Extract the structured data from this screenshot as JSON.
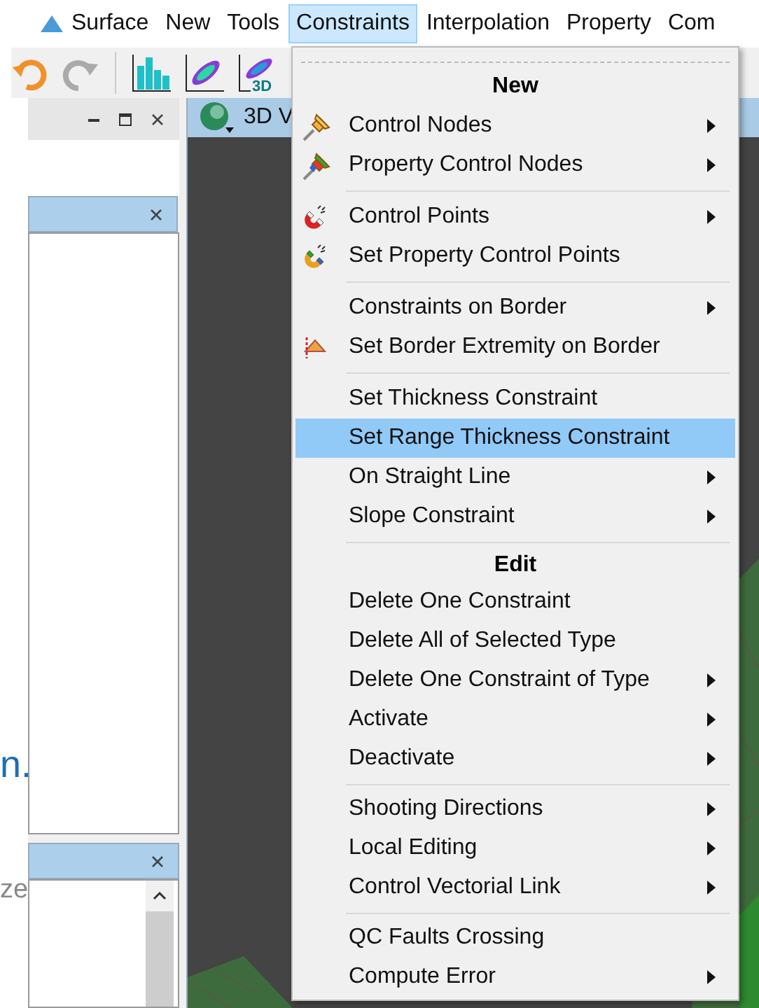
{
  "menu_bar": {
    "items": [
      {
        "label": "Surface",
        "selected": false
      },
      {
        "label": "New",
        "selected": false
      },
      {
        "label": "Tools",
        "selected": false
      },
      {
        "label": "Constraints",
        "selected": true
      },
      {
        "label": "Interpolation",
        "selected": false
      },
      {
        "label": "Property",
        "selected": false
      },
      {
        "label": "Com",
        "selected": false
      }
    ]
  },
  "toolbar": {
    "badge": "3D"
  },
  "left_strip": {
    "link_text": "n.",
    "hint_text": "ze"
  },
  "view_tab": {
    "label": "3D V"
  },
  "constraints_menu": [
    {
      "kind": "header",
      "label": "New"
    },
    {
      "kind": "item",
      "label": "Control Nodes",
      "submenu": true,
      "selected": false
    },
    {
      "kind": "item",
      "label": "Property Control Nodes",
      "submenu": true,
      "selected": false
    },
    {
      "kind": "separator"
    },
    {
      "kind": "item",
      "label": "Control Points",
      "submenu": true,
      "selected": false
    },
    {
      "kind": "item",
      "label": "Set Property Control Points",
      "submenu": false,
      "selected": false
    },
    {
      "kind": "separator"
    },
    {
      "kind": "item",
      "label": "Constraints on Border",
      "submenu": true,
      "selected": false
    },
    {
      "kind": "item",
      "label": "Set Border Extremity on Border",
      "submenu": false,
      "selected": false
    },
    {
      "kind": "separator"
    },
    {
      "kind": "item",
      "label": "Set Thickness Constraint",
      "submenu": false,
      "selected": false
    },
    {
      "kind": "item",
      "label": "Set Range Thickness Constraint",
      "submenu": false,
      "selected": true
    },
    {
      "kind": "item",
      "label": "On Straight Line",
      "submenu": true,
      "selected": false
    },
    {
      "kind": "item",
      "label": "Slope Constraint",
      "submenu": true,
      "selected": false
    },
    {
      "kind": "separator"
    },
    {
      "kind": "header",
      "label": "Edit"
    },
    {
      "kind": "item",
      "label": "Delete One Constraint",
      "submenu": false,
      "selected": false
    },
    {
      "kind": "item",
      "label": "Delete All of Selected Type",
      "submenu": false,
      "selected": false
    },
    {
      "kind": "item",
      "label": "Delete One Constraint of Type",
      "submenu": true,
      "selected": false
    },
    {
      "kind": "item",
      "label": "Activate",
      "submenu": true,
      "selected": false
    },
    {
      "kind": "item",
      "label": "Deactivate",
      "submenu": true,
      "selected": false
    },
    {
      "kind": "separator"
    },
    {
      "kind": "item",
      "label": "Shooting Directions",
      "submenu": true,
      "selected": false
    },
    {
      "kind": "item",
      "label": "Local Editing",
      "submenu": true,
      "selected": false
    },
    {
      "kind": "item",
      "label": "Control Vectorial Link",
      "submenu": true,
      "selected": false
    },
    {
      "kind": "separator"
    },
    {
      "kind": "item",
      "label": "QC Faults Crossing",
      "submenu": false,
      "selected": false
    },
    {
      "kind": "item",
      "label": "Compute Error",
      "submenu": true,
      "selected": false
    }
  ]
}
